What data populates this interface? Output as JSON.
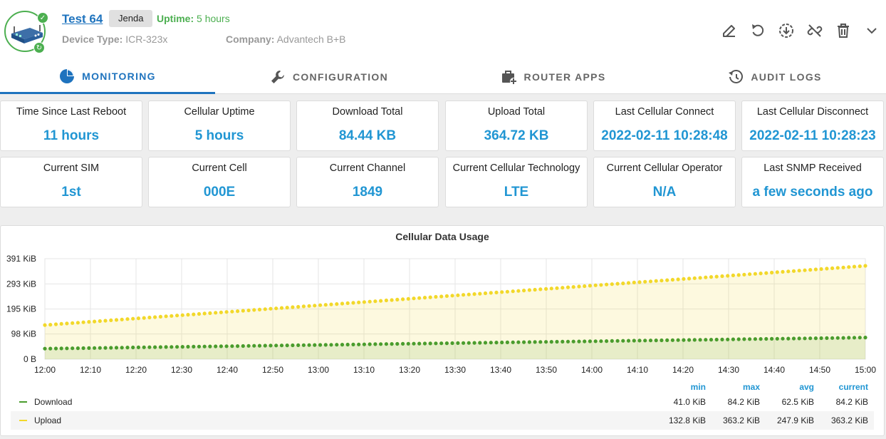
{
  "device": {
    "name": "Test 64",
    "tag": "Jenda",
    "uptime_label": "Uptime:",
    "uptime_value": "5 hours",
    "device_type_label": "Device Type:",
    "device_type": "ICR-323x",
    "company_label": "Company:",
    "company": "Advantech B+B"
  },
  "actions": [
    "edit-icon",
    "restart-icon",
    "download-icon",
    "unlink-icon",
    "delete-icon",
    "chevron-down-icon"
  ],
  "tabs": [
    {
      "label": "MONITORING",
      "icon": "pie-chart-icon",
      "active": true
    },
    {
      "label": "CONFIGURATION",
      "icon": "wrench-icon",
      "active": false
    },
    {
      "label": "ROUTER APPS",
      "icon": "briefcase-add-icon",
      "active": false
    },
    {
      "label": "AUDIT LOGS",
      "icon": "history-icon",
      "active": false
    }
  ],
  "stats": [
    {
      "label": "Time Since Last Reboot",
      "value": "11 hours"
    },
    {
      "label": "Cellular Uptime",
      "value": "5 hours"
    },
    {
      "label": "Download Total",
      "value": "84.44 KB"
    },
    {
      "label": "Upload Total",
      "value": "364.72 KB"
    },
    {
      "label": "Last Cellular Connect",
      "value": "2022-02-11 10:28:48"
    },
    {
      "label": "Last Cellular Disconnect",
      "value": "2022-02-11 10:28:23"
    },
    {
      "label": "Current SIM",
      "value": "1st"
    },
    {
      "label": "Current Cell",
      "value": "000E"
    },
    {
      "label": "Current Channel",
      "value": "1849"
    },
    {
      "label": "Current Cellular Technology",
      "value": "LTE"
    },
    {
      "label": "Current Cellular Operator",
      "value": "N/A"
    },
    {
      "label": "Last SNMP Received",
      "value": "a few seconds ago"
    }
  ],
  "colors": {
    "accent": "#2196d3",
    "link": "#1e73be",
    "success": "#4caf50",
    "download_series": "#4a9c2d",
    "upload_series": "#f2d82a"
  },
  "chart_data": {
    "type": "area",
    "title": "Cellular Data Usage",
    "y_ticks": [
      "391 KiB",
      "293 KiB",
      "195 KiB",
      "98 KiB",
      "0 B"
    ],
    "y_tick_values": [
      391,
      293,
      195,
      98,
      0
    ],
    "ylim": [
      0,
      391
    ],
    "y_unit": "KiB",
    "x_ticks": [
      "12:00",
      "12:10",
      "12:20",
      "12:30",
      "12:40",
      "12:50",
      "13:00",
      "13:10",
      "13:20",
      "13:30",
      "13:40",
      "13:50",
      "14:00",
      "14:10",
      "14:20",
      "14:30",
      "14:40",
      "14:50",
      "15:00"
    ],
    "x_start": "12:00",
    "x_end": "15:00",
    "grid": true,
    "legend_columns": [
      "min",
      "max",
      "avg",
      "current"
    ],
    "series": [
      {
        "name": "Download",
        "start": 41.0,
        "end": 84.2,
        "min": "41.0 KiB",
        "max": "84.2 KiB",
        "avg": "62.5 KiB",
        "current": "84.2 KiB"
      },
      {
        "name": "Upload",
        "start": 132.8,
        "end": 363.2,
        "min": "132.8 KiB",
        "max": "363.2 KiB",
        "avg": "247.9 KiB",
        "current": "363.2 KiB"
      }
    ]
  }
}
